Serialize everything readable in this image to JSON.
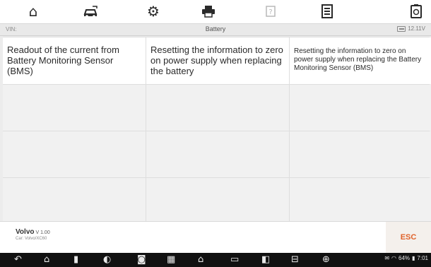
{
  "toolbar": {
    "icons": [
      "home-icon",
      "vehicle-swap-icon",
      "settings-icon",
      "print-icon",
      "help-icon",
      "data-logging-icon",
      "screenshot-icon"
    ]
  },
  "vinbar": {
    "vin_label": "VIN:",
    "title": "Battery",
    "voltage": "12.11V"
  },
  "grid": {
    "rows": [
      [
        "Readout of the current from Battery Monitoring Sensor (BMS)",
        "Resetting the information to zero on power supply when replacing the battery",
        "Resetting the information to zero on power supply when replacing the Battery Monitoring Sensor (BMS)"
      ],
      [
        "",
        "",
        ""
      ],
      [
        "",
        "",
        ""
      ],
      [
        "",
        "",
        ""
      ]
    ]
  },
  "footer": {
    "make": "Volvo",
    "version": "V 1.00",
    "car": "Car: Volvo/XC60",
    "esc_label": "ESC"
  },
  "navbar": {
    "status_text": "64%",
    "clock": "7:01"
  },
  "colors": {
    "accent": "#e0622a",
    "navbar_bg": "#111111"
  }
}
